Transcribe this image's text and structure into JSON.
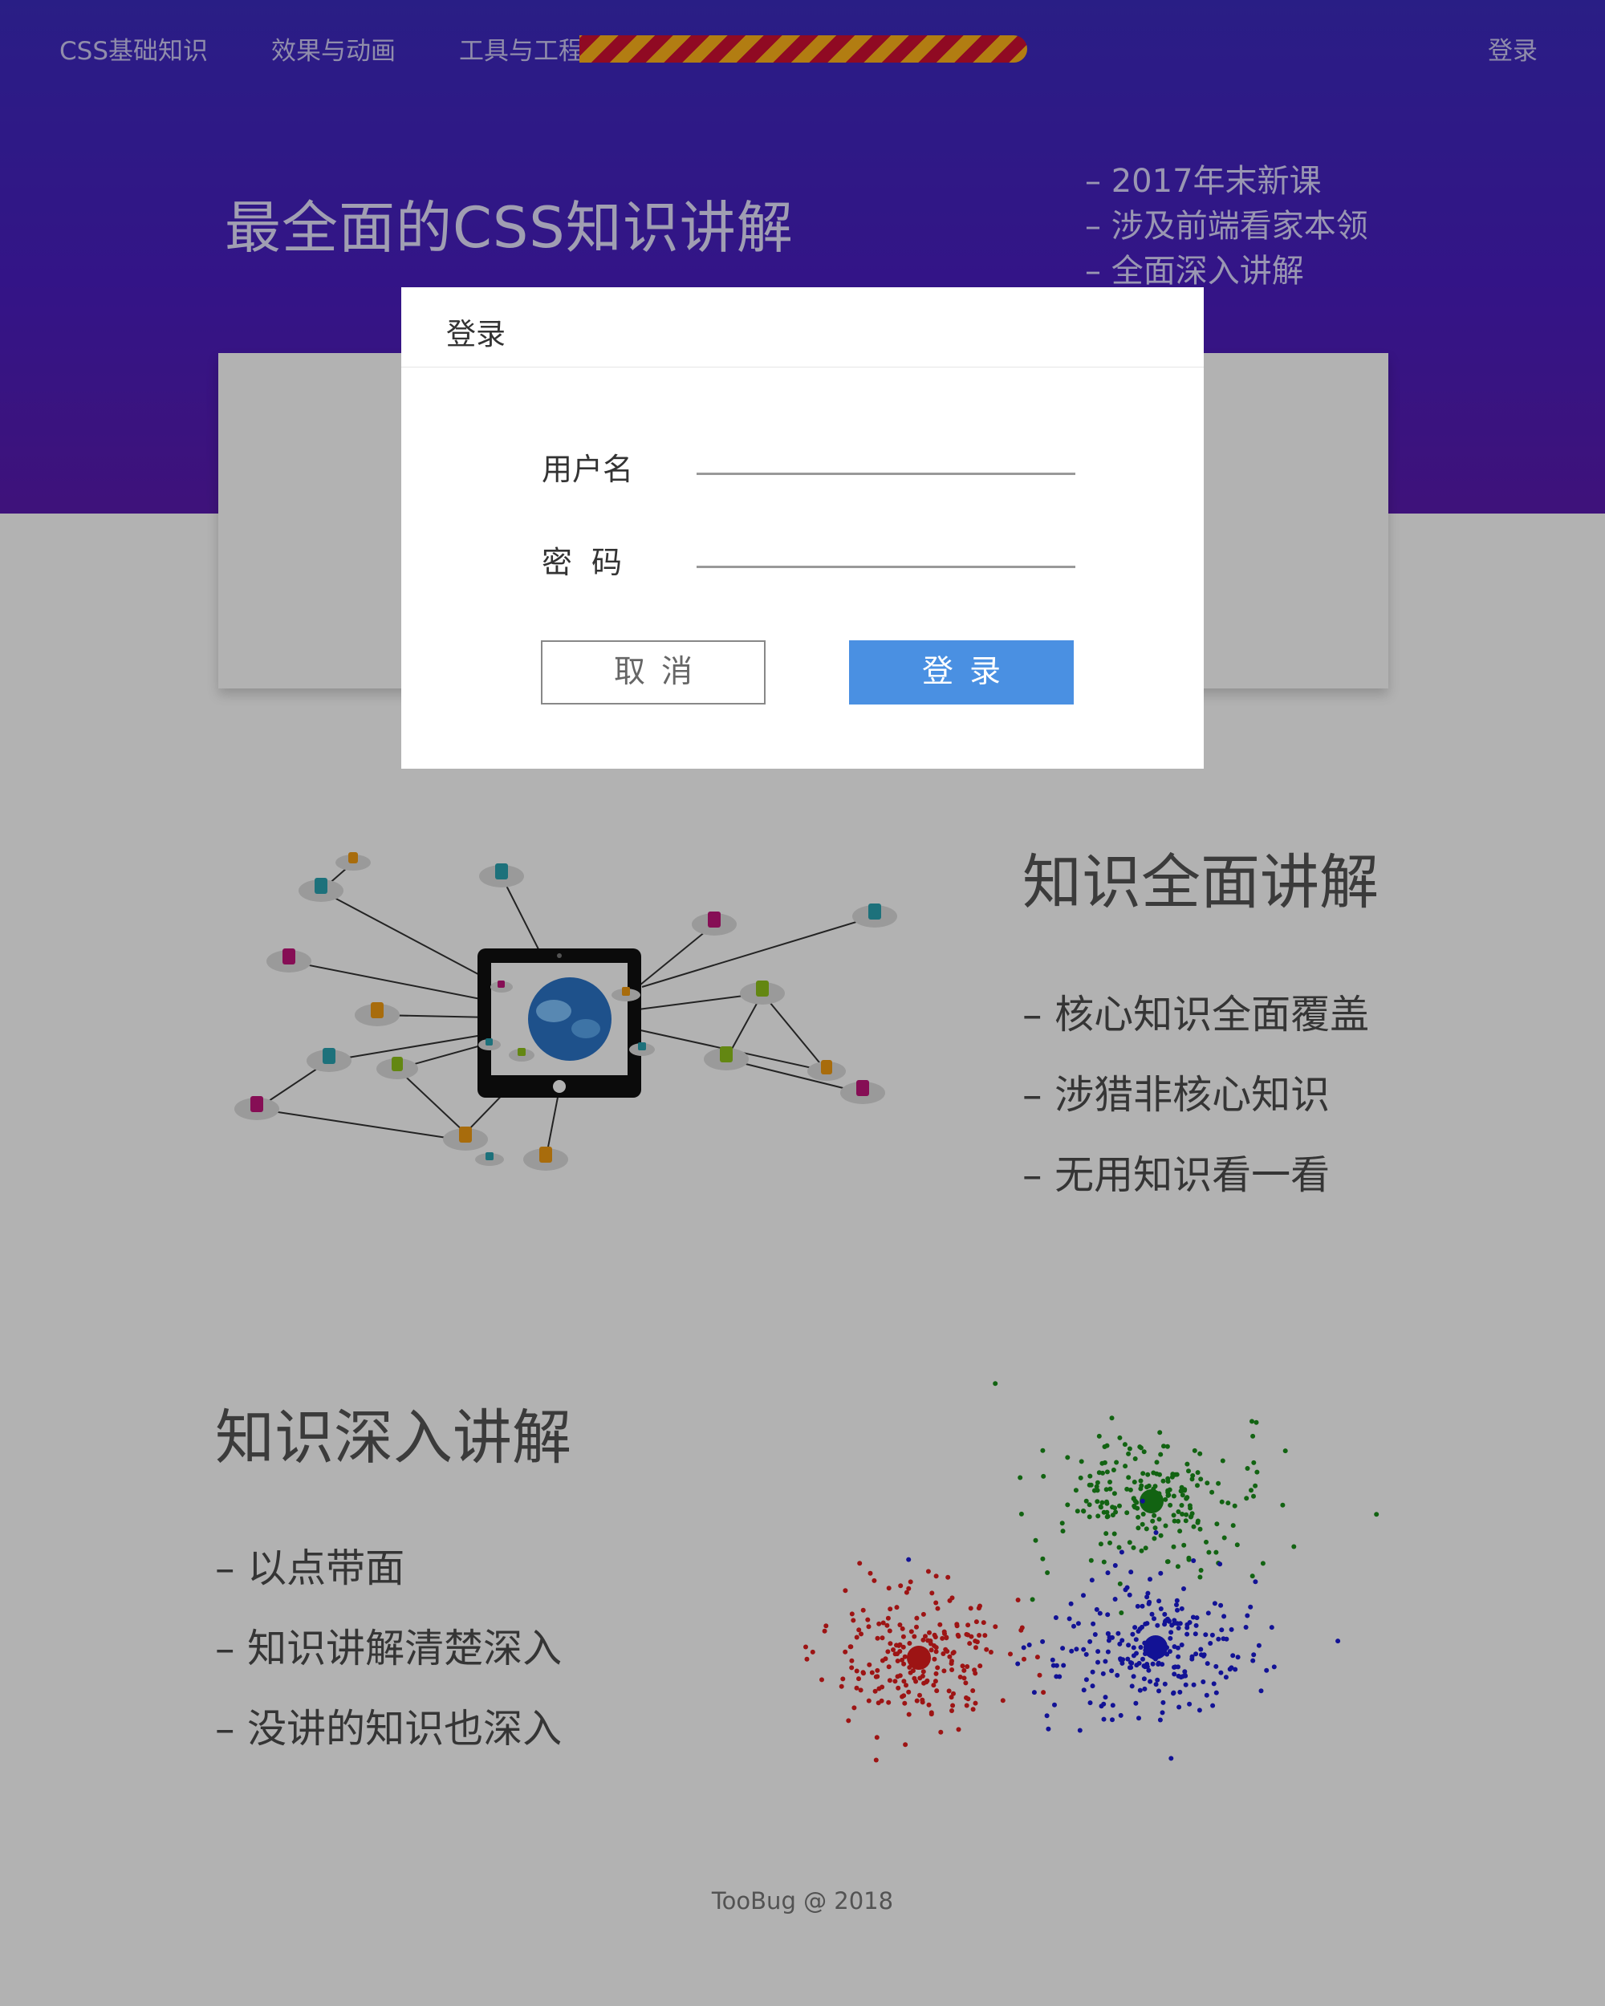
{
  "nav": {
    "items": [
      "CSS基础知识",
      "效果与动画",
      "工具与工程"
    ],
    "login": "登录"
  },
  "hero": {
    "title": "最全面的CSS知识讲解",
    "bullets": [
      "– 2017年末新课",
      "– 涉及前端看家本领",
      "– 全面深入讲解"
    ]
  },
  "section1": {
    "title": "知识全面讲解",
    "items": [
      "– 核心知识全面覆盖",
      "– 涉猎非核心知识",
      "– 无用知识看一看"
    ]
  },
  "section2": {
    "title": "知识深入讲解",
    "items": [
      "– 以点带面",
      "– 知识讲解清楚深入",
      "– 没讲的知识也深入"
    ]
  },
  "footer": {
    "text": "TooBug @ 2018"
  },
  "modal": {
    "title": "登录",
    "username_label": "用户名",
    "password_label": "密码",
    "username_value": "",
    "password_value": "",
    "cancel_label": "取消",
    "login_label": "登录"
  },
  "colors": {
    "hero_top": "#3c2bbf",
    "hero_bottom": "#5a1bb0",
    "accent_button": "#4a90e2",
    "stripe_orange": "#ffb31a",
    "stripe_red": "#cf0f33",
    "cluster_red": "#e11d1d",
    "cluster_green": "#1a8f1a",
    "cluster_blue": "#1a1ad6"
  }
}
